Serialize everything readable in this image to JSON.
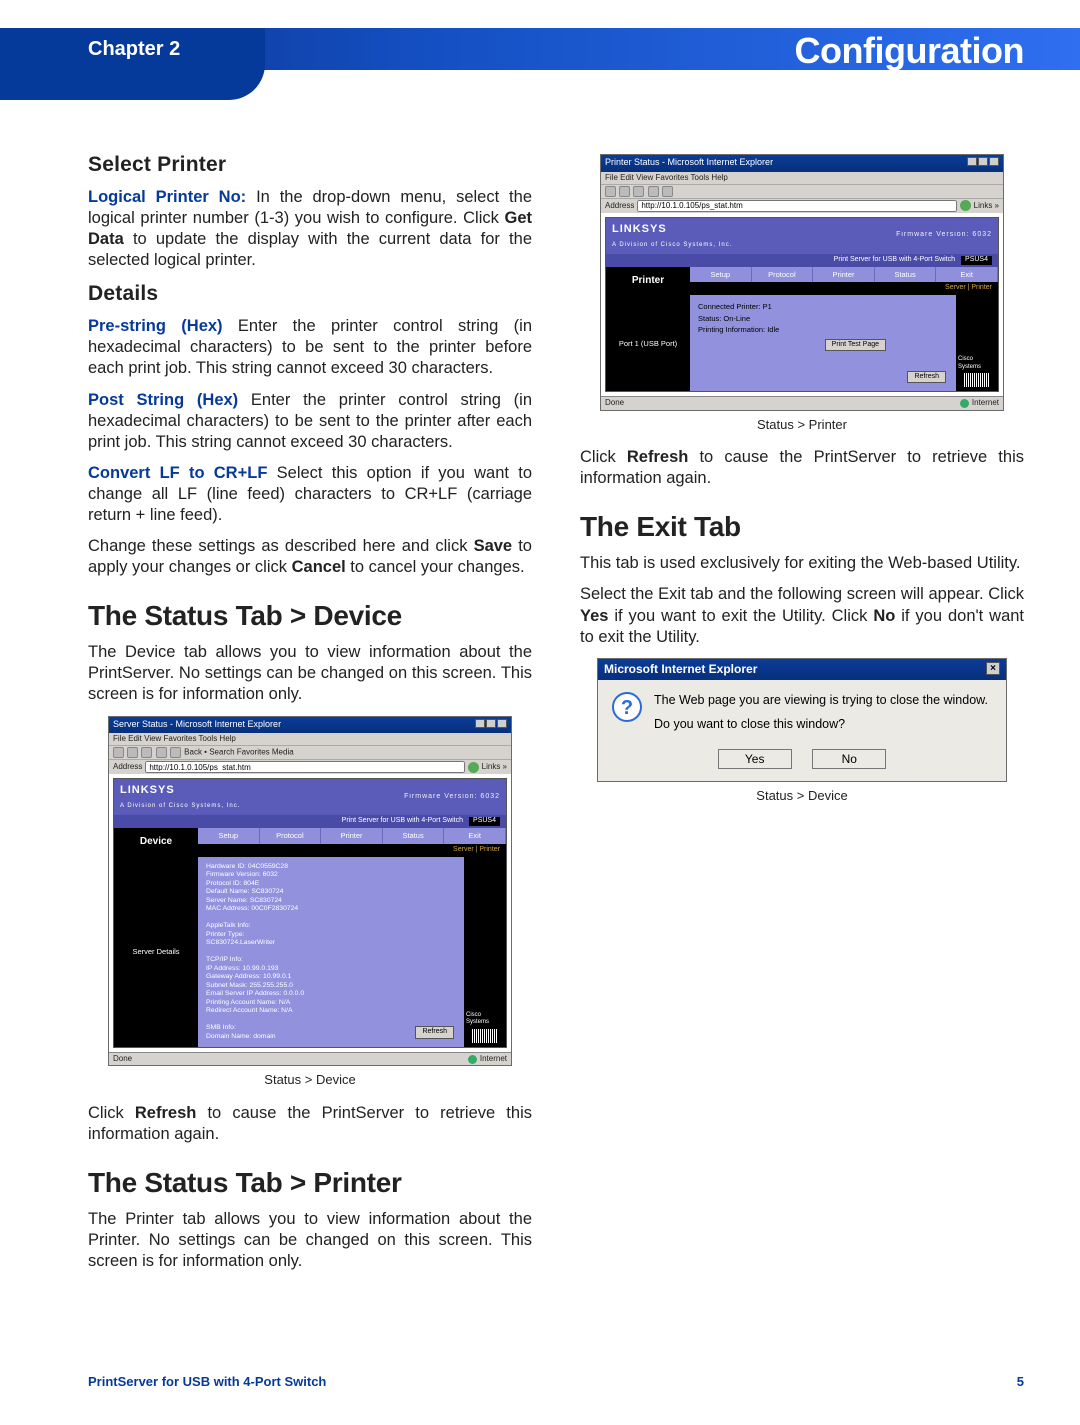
{
  "header": {
    "chapter": "Chapter 2",
    "title": "Configuration"
  },
  "left": {
    "select_printer_heading": "Select Printer",
    "sp_term": "Logical Printer No:",
    "sp_text1": "In the drop-down menu, select the logical printer number (1-3) you wish to configure. Click ",
    "sp_bold": "Get Data",
    "sp_text2": " to update the display with the current data for the selected logical printer.",
    "details_heading": "Details",
    "d1_term": "Pre-string (Hex)",
    "d1_text": " Enter the printer control string (in hexadecimal characters) to be sent to the printer before each print job. This string cannot exceed 30 characters.",
    "d2_term": "Post String (Hex)",
    "d2_text": " Enter the printer control string (in hexadecimal characters) to be sent to the printer after each print job. This string cannot exceed 30 characters.",
    "d3_term": "Convert LF to CR+LF",
    "d3_text": "  Select this option if you want to change all LF (line feed) characters to CR+LF (carriage return + line feed).",
    "d4_text1": "Change these settings as described here and click ",
    "d4_b1": "Save",
    "d4_text2": " to apply your changes or click ",
    "d4_b2": "Cancel",
    "d4_text3": " to cancel your changes.",
    "status_device_heading": "The Status Tab > Device",
    "sd_para": "The Device tab allows you to view information about the PrintServer. No settings can be changed on this screen. This screen is for information only.",
    "fig1_caption": "Status > Device",
    "refresh_text1": "Click ",
    "refresh_bold": "Refresh",
    "refresh_text2": " to cause the PrintServer to retrieve this information again.",
    "status_printer_heading": "The Status Tab > Printer",
    "sp_para": "The Printer tab allows you to view information about the Printer. No settings can be changed on this screen. This screen is for information only."
  },
  "right": {
    "fig2_caption": "Status > Printer",
    "refresh_text1": "Click ",
    "refresh_bold": "Refresh",
    "refresh_text2": " to cause the PrintServer to retrieve this information again.",
    "exit_heading": "The Exit Tab",
    "exit_p1": "This tab is used exclusively for exiting the Web-based Utility.",
    "exit_p2a": "Select the Exit tab and the following screen will appear. Click ",
    "exit_b1": "Yes",
    "exit_p2b": " if you want to exit the Utility. Click ",
    "exit_b2": "No",
    "exit_p2c": " if you don't want to exit the Utility.",
    "fig3_caption": "Status > Device"
  },
  "win_device": {
    "title": "Server Status - Microsoft Internet Explorer",
    "menu": "File  Edit  View  Favorites  Tools  Help",
    "toolbar": "Back  •        Search   Favorites   Media",
    "addr_label": "Address",
    "addr_value": "http://10.1.0.105/ps_stat.htm",
    "links": "Links »",
    "brand": "LINKSYS",
    "brand_sub": "A Division of Cisco Systems, Inc.",
    "fw": "Firmware Version:  6032",
    "model_bar_label": "Print Server for USB with 4-Port Switch",
    "model": "PSUS4",
    "side_main": "Device",
    "tabs": [
      "Setup",
      "Protocol",
      "Printer",
      "Status",
      "Exit"
    ],
    "subtabs": "Server | Printer",
    "side_body": "Server Details",
    "lines": [
      "Hardware ID: 04C0559C28",
      "Firmware Version: 6032",
      "Protocol ID: 804E",
      "Default Name: SC830724",
      "Server Name: SC830724",
      "MAC Address: 00C0F2830724",
      "",
      "AppleTalk Info:",
      "Printer Type:",
      "SC830724.LaserWriter",
      "",
      "TCP/IP Info:",
      "IP Address: 10.99.0.193",
      "Gateway Address: 10.99.0.1",
      "Subnet Mask: 255.255.255.0",
      "Email Server IP Address: 0.0.0.0",
      "Printing Account Name: N/A",
      "Redirect Account Name: N/A",
      "",
      "SMB Info:",
      "Domain Name: domain"
    ],
    "btn": "Refresh",
    "corner": "Cisco Systems",
    "status_done": "Done",
    "status_net": "Internet"
  },
  "win_printer": {
    "title": "Printer Status - Microsoft Internet Explorer",
    "menu": "File  Edit  View  Favorites  Tools  Help",
    "addr_label": "Address",
    "addr_value": "http://10.1.0.105/ps_stat.htm",
    "links": "Links »",
    "brand": "LINKSYS",
    "brand_sub": "A Division of Cisco Systems, Inc.",
    "fw": "Firmware Version:  6032",
    "model_bar_label": "Print Server for USB with 4-Port Switch",
    "model": "PSUS4",
    "side_main": "Printer",
    "tabs": [
      "Setup",
      "Protocol",
      "Printer",
      "Status",
      "Exit"
    ],
    "subtabs": "Server | Printer",
    "side_body": "Port 1 (USB Port)",
    "lines": [
      "Connected Printer:   P1",
      "Status:                        On-Line",
      "Printing Information:  Idle"
    ],
    "btn_test": "Print Test Page",
    "btn": "Refresh",
    "corner": "Cisco Systems",
    "status_done": "Done",
    "status_net": "Internet"
  },
  "dialog": {
    "title": "Microsoft Internet Explorer",
    "line1": "The Web page you are viewing is trying to close the window.",
    "line2": "Do you want to close this window?",
    "yes": "Yes",
    "no": "No"
  },
  "footer": {
    "product": "PrintServer for USB with 4-Port Switch",
    "page": "5"
  }
}
